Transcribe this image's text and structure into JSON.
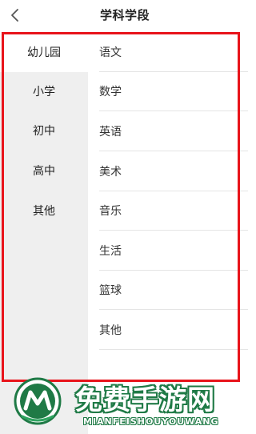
{
  "header": {
    "title": "学科学段",
    "back_icon": "chevron-left-icon"
  },
  "sidebar": {
    "items": [
      {
        "label": "幼儿园",
        "active": true
      },
      {
        "label": "小学",
        "active": false
      },
      {
        "label": "初中",
        "active": false
      },
      {
        "label": "高中",
        "active": false
      },
      {
        "label": "其他",
        "active": false
      }
    ]
  },
  "subjects": {
    "items": [
      {
        "label": "语文"
      },
      {
        "label": "数学"
      },
      {
        "label": "英语"
      },
      {
        "label": "美术"
      },
      {
        "label": "音乐"
      },
      {
        "label": "生活"
      },
      {
        "label": "篮球"
      },
      {
        "label": "其他"
      }
    ]
  },
  "annotation": {
    "highlight_color": "#e8141b"
  },
  "watermark": {
    "title": "免费手游网",
    "subtitle": "MIANFEISHOUYOUWANG",
    "brand_color": "#1f7a46"
  }
}
